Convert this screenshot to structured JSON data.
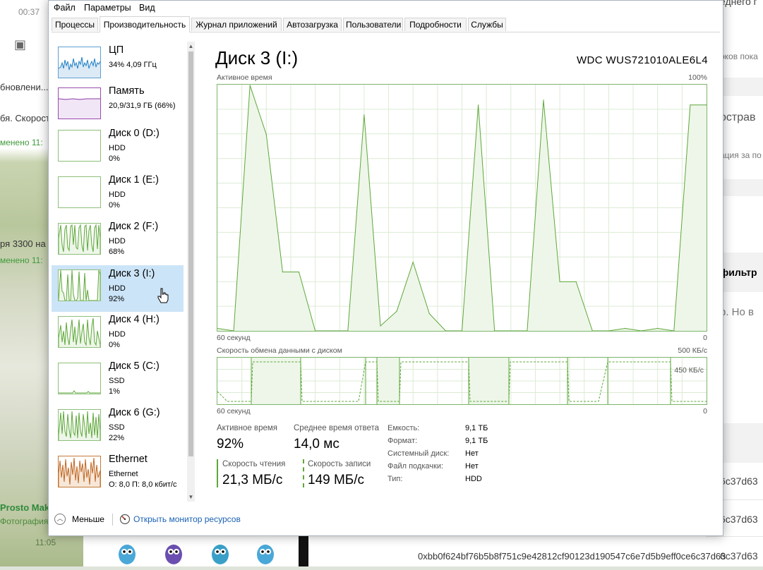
{
  "background_left": {
    "lines": [
      "00:37",
      "бновлени...",
      "бя. Скорост",
      "менено 11:",
      "ря 3300 на",
      "менено 11:",
      "Prosto Maks",
      "Фотография",
      "11:05"
    ]
  },
  "background_right": {
    "lines": [
      "еднего г",
      "оков пока",
      "острав",
      "ация за по",
      "фильтр",
      "р. Но в",
      "6c37d63",
      "6c37d63",
      "6c37d63"
    ]
  },
  "background_bottom": {
    "hash": "0xbb0f624bf76b5b8f751c9e42812cf90123d190547c6e7d5b9eff0ce6c37d63"
  },
  "menu": [
    "Файл",
    "Параметры",
    "Вид"
  ],
  "tabs": [
    "Процессы",
    "Производительность",
    "Журнал приложений",
    "Автозагрузка",
    "Пользователи",
    "Подробности",
    "Службы"
  ],
  "active_tab": "Производительность",
  "sidebar": {
    "items": [
      {
        "title": "ЦП",
        "line1": "34%  4,09 ГГц",
        "line2": ""
      },
      {
        "title": "Память",
        "line1": "20,9/31,9 ГБ (66%)",
        "line2": ""
      },
      {
        "title": "Диск 0 (D:)",
        "line1": "HDD",
        "line2": "0%"
      },
      {
        "title": "Диск 1 (E:)",
        "line1": "HDD",
        "line2": "0%"
      },
      {
        "title": "Диск 2 (F:)",
        "line1": "HDD",
        "line2": "68%"
      },
      {
        "title": "Диск 3 (I:)",
        "line1": "HDD",
        "line2": "92%"
      },
      {
        "title": "Диск 4 (H:)",
        "line1": "HDD",
        "line2": "0%"
      },
      {
        "title": "Диск 5 (C:)",
        "line1": "SSD",
        "line2": "1%"
      },
      {
        "title": "Диск 6 (G:)",
        "line1": "SSD",
        "line2": "22%"
      },
      {
        "title": "Ethernet",
        "line1": "Ethernet",
        "line2": "О: 8,0  П: 8,0 кбит/с"
      }
    ],
    "selected_index": 5
  },
  "detail": {
    "title": "Диск 3 (I:)",
    "model": "WDC  WUS721010ALE6L4",
    "chart1_label": "Активное время",
    "chart1_max": "100%",
    "chart1_xlabel": "60 секунд",
    "chart1_xmin": "0",
    "chart2_label": "Скорость обмена данными с диском",
    "chart2_max": "500 КБ/с",
    "chart2_mid": "450 КБ/с",
    "chart2_xlabel": "60 секунд",
    "chart2_xmin": "0",
    "stats": {
      "active_label": "Активное время",
      "active_value": "92%",
      "response_label": "Среднее время ответа",
      "response_value": "14,0 мс",
      "read_label": "Скорость чтения",
      "read_value": "21,3 МБ/с",
      "write_label": "Скорость записи",
      "write_value": "149 МБ/с"
    },
    "properties": [
      {
        "key": "Емкость:",
        "value": "9,1 ТБ"
      },
      {
        "key": "Формат:",
        "value": "9,1 ТБ"
      },
      {
        "key": "Системный диск:",
        "value": "Нет"
      },
      {
        "key": "Файл подкачки:",
        "value": "Нет"
      },
      {
        "key": "Тип:",
        "value": "HDD"
      }
    ]
  },
  "footer": {
    "less": "Меньше",
    "monitor": "Открыть монитор ресурсов"
  },
  "colors": {
    "disk_green": "#5ea83a",
    "disk_fill": "#eef6e9",
    "selection": "#cce4f7",
    "link": "#1a62b4",
    "cpu_blue": "#1d7fc4",
    "mem_purple": "#8b3fa8",
    "eth_orange": "#c0651f"
  },
  "chart_data": {
    "type": "area",
    "title": "Активное время",
    "ylabel": "Активное время (%)",
    "ylim": [
      0,
      100
    ],
    "x": [
      60,
      58,
      56,
      54,
      52,
      50,
      48,
      46,
      44,
      42,
      40,
      38,
      36,
      34,
      32,
      30,
      28,
      26,
      24,
      22,
      20,
      18,
      16,
      14,
      12,
      10,
      8,
      6,
      4,
      2,
      0
    ],
    "series": [
      {
        "values": [
          1,
          0,
          100,
          80,
          24,
          24,
          0,
          0,
          0,
          88,
          2,
          8,
          28,
          7,
          0,
          0,
          92,
          0,
          0,
          0,
          94,
          20,
          20,
          0,
          0,
          1,
          0,
          1,
          0,
          92,
          92
        ]
      }
    ]
  }
}
